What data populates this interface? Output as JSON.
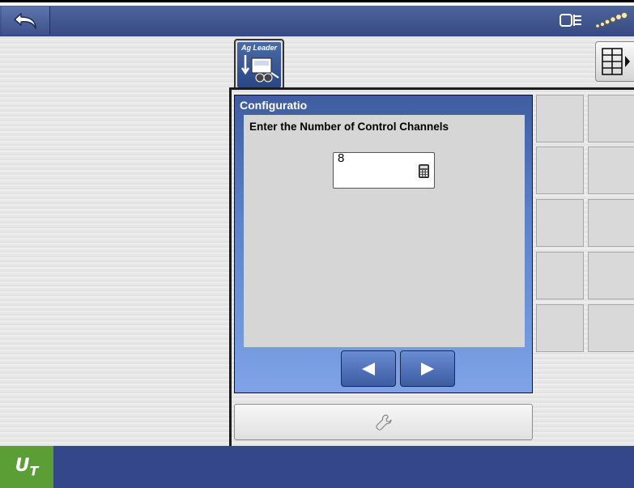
{
  "topbar": {
    "back_icon": "back-arrow-icon",
    "status_icons": [
      "display-status-icon",
      "signal-icon"
    ]
  },
  "app_tab": {
    "label": "Ag Leader",
    "icon": "planter-icon"
  },
  "dialog": {
    "title": "Configuratio",
    "prompt": "Enter the Number of Control Channels",
    "value": "8",
    "value_icon": "calculator-icon",
    "prev_icon": "arrow-left-icon",
    "next_icon": "arrow-right-icon"
  },
  "tools_icon": "wrench-icon",
  "footer": {
    "logo_main": "U",
    "logo_sub": "T"
  },
  "colors": {
    "bar_blue": "#33478a",
    "dialog_blue": "#5c80c9",
    "logo_green": "#5a9e35"
  }
}
